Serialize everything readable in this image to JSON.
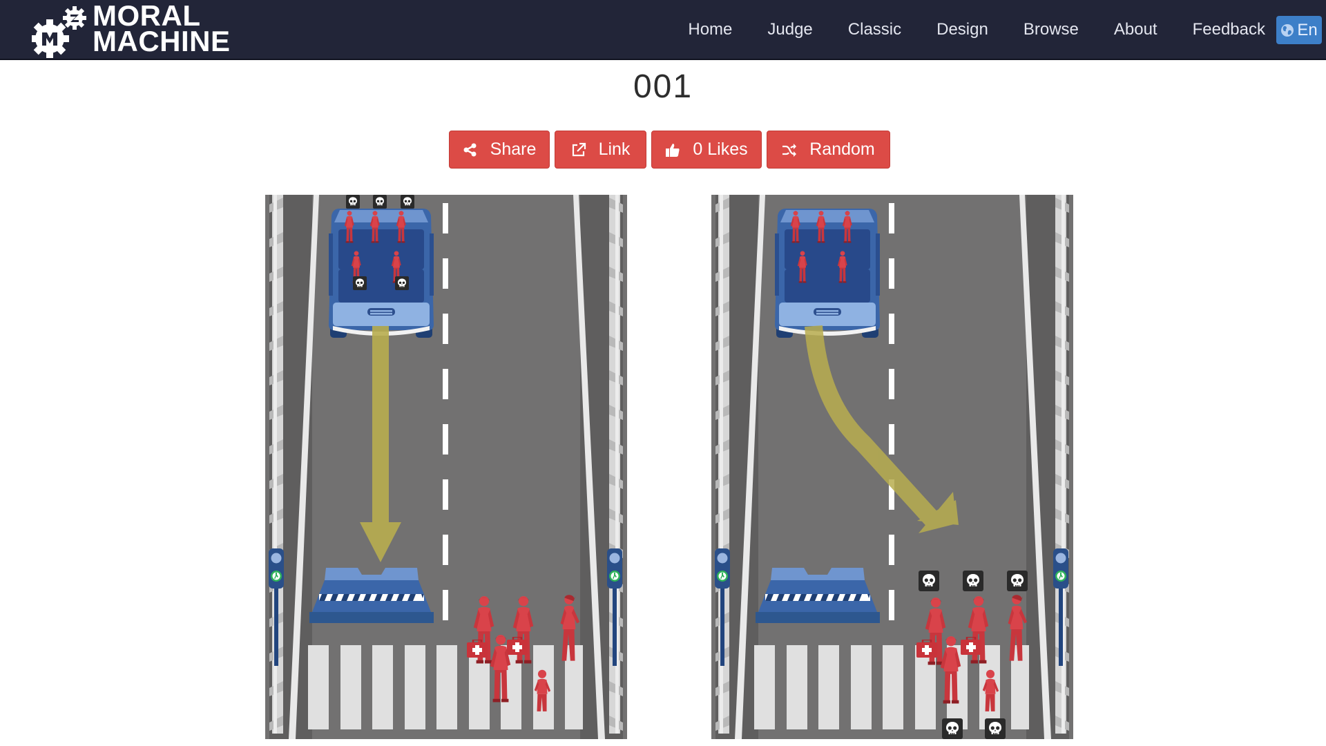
{
  "brand": {
    "line1": "MORAL",
    "line2": "MACHINE"
  },
  "nav": {
    "items": [
      "Home",
      "Judge",
      "Classic",
      "Design",
      "Browse",
      "About",
      "Feedback"
    ],
    "language": "En"
  },
  "page": {
    "title": "001"
  },
  "actions": {
    "share": "Share",
    "link": "Link",
    "likes": "0 Likes",
    "random": "Random"
  },
  "colors": {
    "navbar": "#222538",
    "button": "#dc4b46",
    "language_button": "#3d7fc8",
    "road": "#727171",
    "victim": "#d9434a",
    "vehicle": "#3b66a9",
    "arrow": "#b8ad4f"
  },
  "scenarios": [
    {
      "id": "left",
      "vehicle_outcome": "stays straight, crashes into barrier",
      "passengers_dead": 5,
      "pedestrians_dead": 0,
      "icons": [
        "car-icon",
        "barrier-icon",
        "pedestrian-icon",
        "skull-icon",
        "traffic-light-icon"
      ]
    },
    {
      "id": "right",
      "vehicle_outcome": "swerves into crosswalk",
      "passengers_dead": 0,
      "pedestrians_dead": 5,
      "icons": [
        "car-icon",
        "barrier-icon",
        "pedestrian-icon",
        "skull-icon",
        "traffic-light-icon"
      ]
    }
  ]
}
